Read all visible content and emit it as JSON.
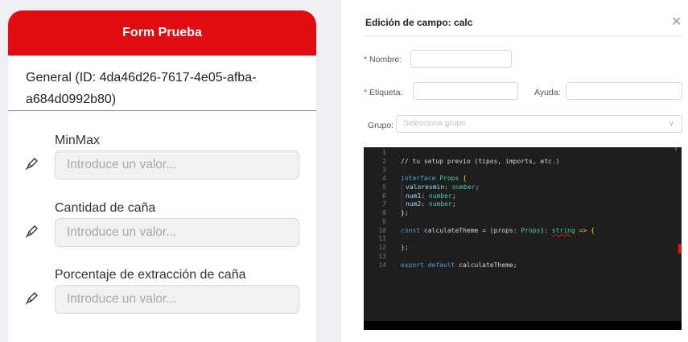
{
  "form": {
    "header_title": "Form Prueba",
    "section_title": "General (ID: 4da46d26-7617-4e05-afba-a684d0992b80)",
    "fields": [
      {
        "label": "MinMax",
        "placeholder": "Introduce un valor...",
        "icon": "pencil-icon"
      },
      {
        "label": "Cantidad de caña",
        "placeholder": "Introduce un valor...",
        "icon": "pencil-icon"
      },
      {
        "label": "Porcentaje de extracción de caña",
        "placeholder": "Introduce un valor...",
        "icon": "pencil-icon"
      }
    ]
  },
  "modal": {
    "title": "Edición de campo: calc",
    "close_icon": "close-icon",
    "required_mark": "*",
    "nombre_label": "Nombre:",
    "nombre_value": "",
    "etiqueta_label": "Etiqueta:",
    "etiqueta_value": "",
    "ayuda_label": "Ayuda:",
    "ayuda_value": "",
    "grupo_label": "Grupo:",
    "grupo_placeholder": "Selecciona grupo"
  },
  "editor": {
    "line_numbers": [
      "1",
      "2",
      "3",
      "4",
      "5",
      "6",
      "7",
      "8",
      "9",
      "10",
      "11",
      "12",
      "13",
      "14"
    ],
    "comment": "// tu setup previo (tipos, imports, etc.)",
    "interface_kw": "interface",
    "interface_name": "Props",
    "open_brace": "{",
    "props": [
      {
        "name": "valoresmin",
        "type": "number"
      },
      {
        "name": "num1",
        "type": "number"
      },
      {
        "name": "num2",
        "type": "number"
      }
    ],
    "close_brace": "};",
    "const_kw": "const",
    "func_name": "calculateTheme",
    "func_eq": " = (props: ",
    "func_param_type": "Props",
    "func_mid": "): ",
    "func_return_type": "string",
    "func_arrow": " => {",
    "func_close": "};",
    "export_kw": "export default",
    "export_name": "calculateTheme;"
  },
  "colors": {
    "brand_red": "#e30b12",
    "required": "#e53935",
    "editor_bg": "#1e1e1e"
  }
}
